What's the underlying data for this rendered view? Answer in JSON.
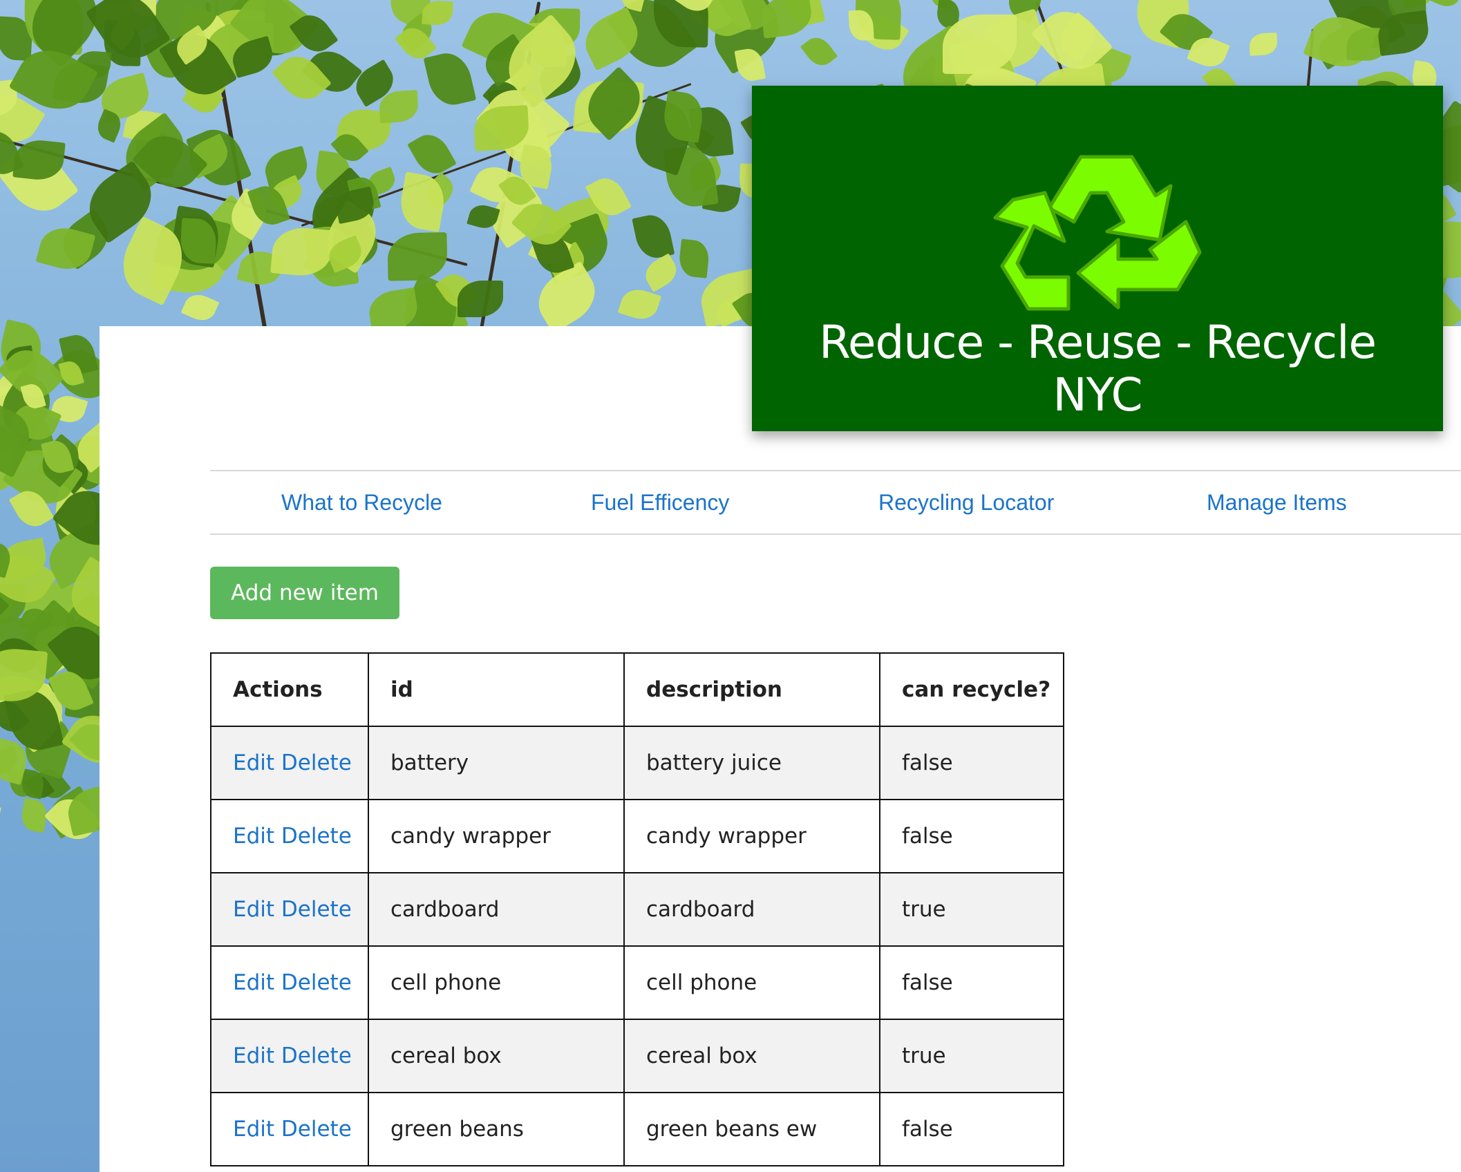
{
  "header": {
    "title_line1": "Reduce - Reuse - Recycle",
    "title_line2": "NYC",
    "logo_icon": "recycle-icon"
  },
  "nav": {
    "items": [
      {
        "label": "What to Recycle"
      },
      {
        "label": "Fuel Efficency"
      },
      {
        "label": "Recycling Locator"
      },
      {
        "label": "Manage Items"
      }
    ]
  },
  "actions": {
    "add_label": "Add new item"
  },
  "table": {
    "headers": [
      "Actions",
      "id",
      "description",
      "can recycle?"
    ],
    "edit_label": "Edit",
    "delete_label": "Delete",
    "rows": [
      {
        "id": "battery",
        "description": "battery juice",
        "can_recycle": "false"
      },
      {
        "id": "candy wrapper",
        "description": "candy wrapper",
        "can_recycle": "false"
      },
      {
        "id": "cardboard",
        "description": "cardboard",
        "can_recycle": "true"
      },
      {
        "id": "cell phone",
        "description": "cell phone",
        "can_recycle": "false"
      },
      {
        "id": "cereal box",
        "description": "cereal box",
        "can_recycle": "true"
      },
      {
        "id": "green beans",
        "description": "green beans ew",
        "can_recycle": "false"
      }
    ]
  },
  "colors": {
    "logo_bg": "#006400",
    "recycle_green": "#7cfc00",
    "link": "#1a73c9",
    "button": "#5cb85c"
  }
}
